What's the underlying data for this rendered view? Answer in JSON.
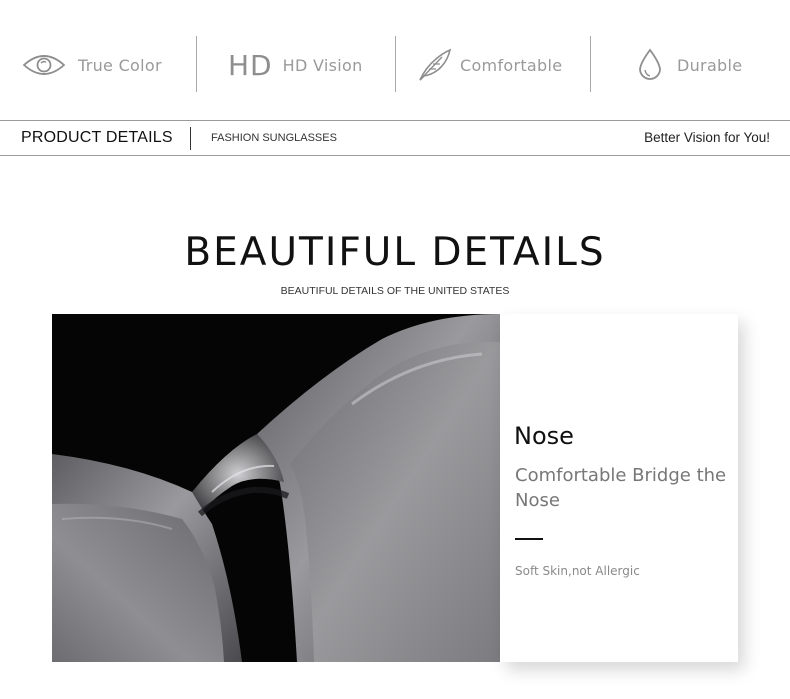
{
  "features": [
    {
      "label": "True Color",
      "icon": "eye-icon"
    },
    {
      "mark": "HD",
      "label": "HD Vision",
      "icon": "hd-icon"
    },
    {
      "label": "Comfortable",
      "icon": "feather-icon"
    },
    {
      "label": "Durable",
      "icon": "water-drop-icon"
    }
  ],
  "details_bar": {
    "title": "PRODUCT DETAILS",
    "subtitle": "FASHION SUNGLASSES",
    "tagline": "Better Vision for You!"
  },
  "headline": {
    "title": "BEAUTIFUL DETAILS",
    "subtitle": "BEAUTIFUL DETAILS OF THE UNITED STATES"
  },
  "detail_card": {
    "title": "Nose",
    "description": "Comfortable Bridge the Nose",
    "note": "Soft Skin,not Allergic"
  },
  "colors": {
    "icon_gray": "#8e8e8e",
    "text_gray": "#9a9a9a",
    "photo_background": "#050505",
    "frame_gray": "#6f6f72",
    "lens_gray": "#8d8c8f"
  }
}
